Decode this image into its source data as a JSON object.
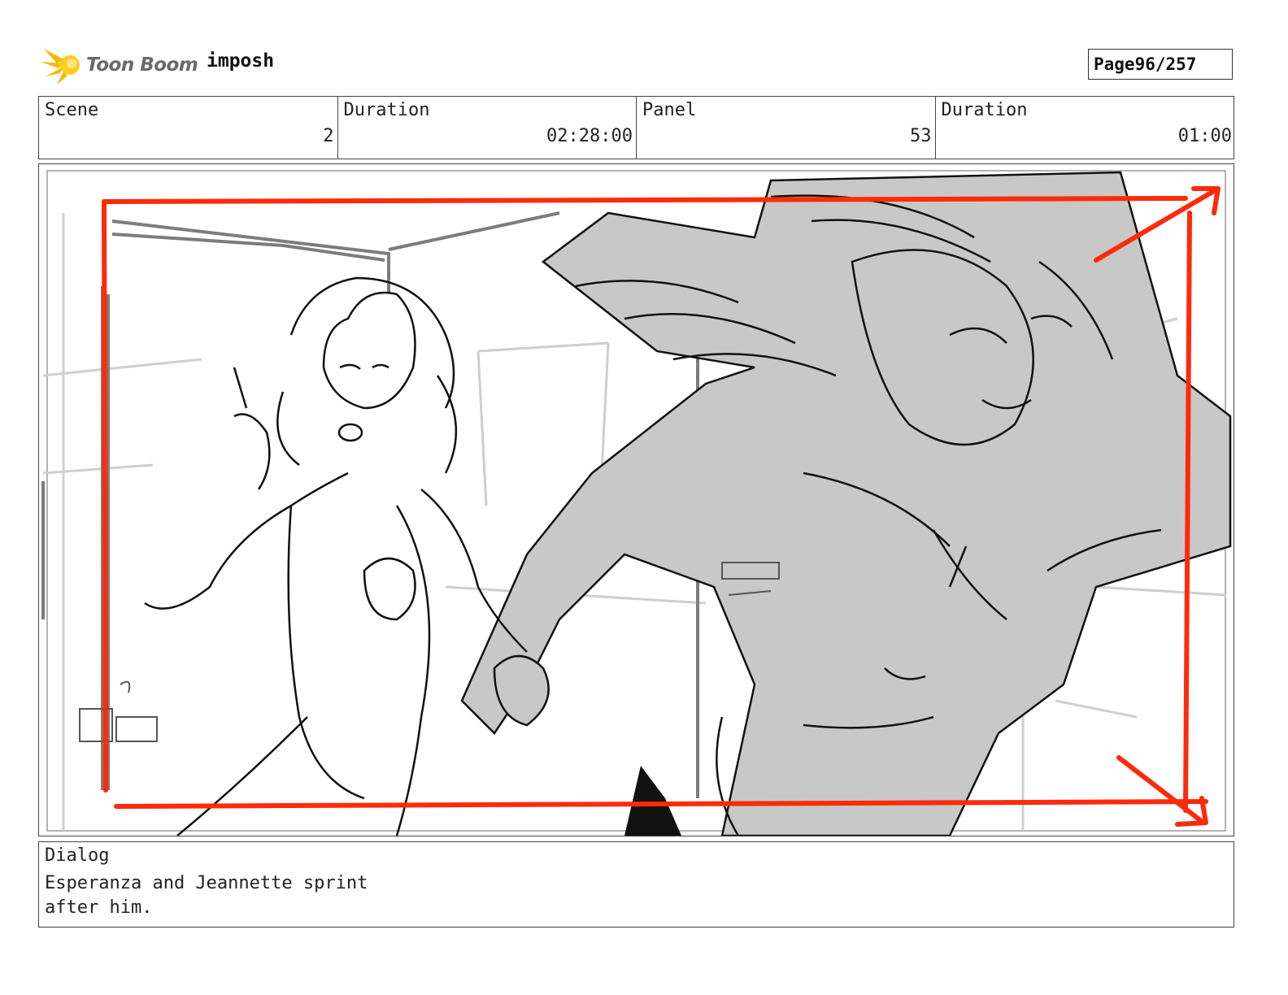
{
  "header": {
    "logo_text": "Toon Boom",
    "project_name": "imposh",
    "page_label": "Page",
    "page_value": "96/257"
  },
  "info": {
    "scene_label": "Scene",
    "scene_value": "2",
    "scene_duration_label": "Duration",
    "scene_duration_value": "02:28:00",
    "panel_label": "Panel",
    "panel_value": "53",
    "panel_duration_label": "Duration",
    "panel_duration_value": "01:00"
  },
  "dialog": {
    "label": "Dialog",
    "text": "Esperanza and Jeannette sprint after him."
  },
  "colors": {
    "camera_move": "#ff2a0a",
    "sketch_fill": "#c8c8c8",
    "ink": "#111111",
    "logo_burst": "#f5b800"
  }
}
